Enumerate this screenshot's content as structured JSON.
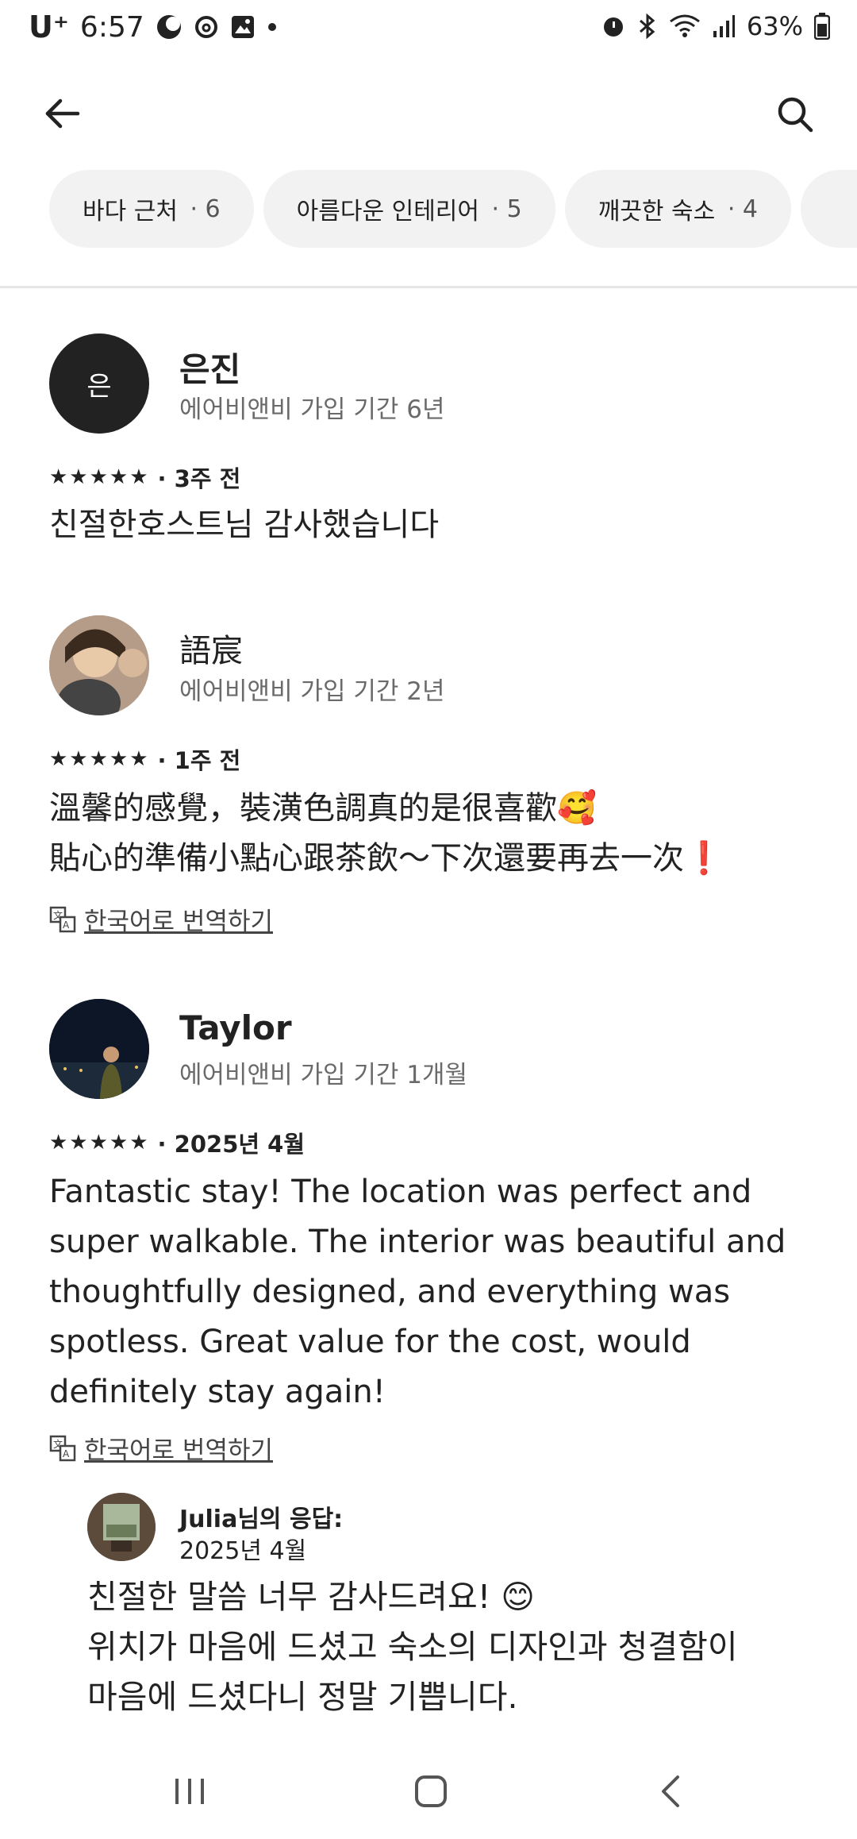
{
  "status_bar": {
    "carrier": "U⁺",
    "time": "6:57",
    "battery": "63%",
    "left_icons": [
      "moon-icon",
      "threads-icon",
      "gallery-icon",
      "dot-icon"
    ],
    "right_icons": [
      "alarm-icon",
      "bluetooth-icon",
      "wifi-icon",
      "signal-icon",
      "battery-icon"
    ]
  },
  "header": {
    "back_icon": "arrow-left-icon",
    "search_icon": "search-icon"
  },
  "filter_chips": [
    {
      "label": "바다 근처",
      "count": "· 6"
    },
    {
      "label": "아름다운 인테리어",
      "count": "· 5"
    },
    {
      "label": "깨끗한 숙소",
      "count": "· 4"
    }
  ],
  "reviews": [
    {
      "avatar_initial": "은",
      "name": "은진",
      "member_since": "에어비앤비 가입 기간 6년",
      "stars": "★★★★★",
      "date": "· 3주 전",
      "text": "친절한호스트님 감사했습니다"
    },
    {
      "name": "語宸",
      "member_since": "에어비앤비 가입 기간 2년",
      "stars": "★★★★★",
      "date": "· 1주 전",
      "text": "溫馨的感覺，裝潢色調真的是很喜歡🥰\n貼心的準備小點心跟茶飲～下次還要再去一次❗",
      "translate_label": "한국어로 번역하기"
    },
    {
      "name": "Taylor",
      "member_since": "에어비앤비 가입 기간 1개월",
      "stars": "★★★★★",
      "date": "· 2025년 4월",
      "text": "Fantastic stay! The location was perfect and\nsuper walkable. The interior was beautiful and\nthoughtfully designed, and everything was\nspotless. Great value for the cost, would\ndefinitely stay again!",
      "translate_label": "한국어로 번역하기"
    }
  ],
  "host_reply": {
    "name": "Julia님의 응답:",
    "date": "2025년 4월",
    "text": "친절한 말씀 너무 감사드려요! 😊\n위치가 마음에 드셨고 숙소의 디자인과 청결함이\n마음에 드셨다니 정말 기쁩니다."
  },
  "nav_bar": {
    "icons": [
      "recent-apps-icon",
      "home-icon",
      "back-icon"
    ]
  }
}
